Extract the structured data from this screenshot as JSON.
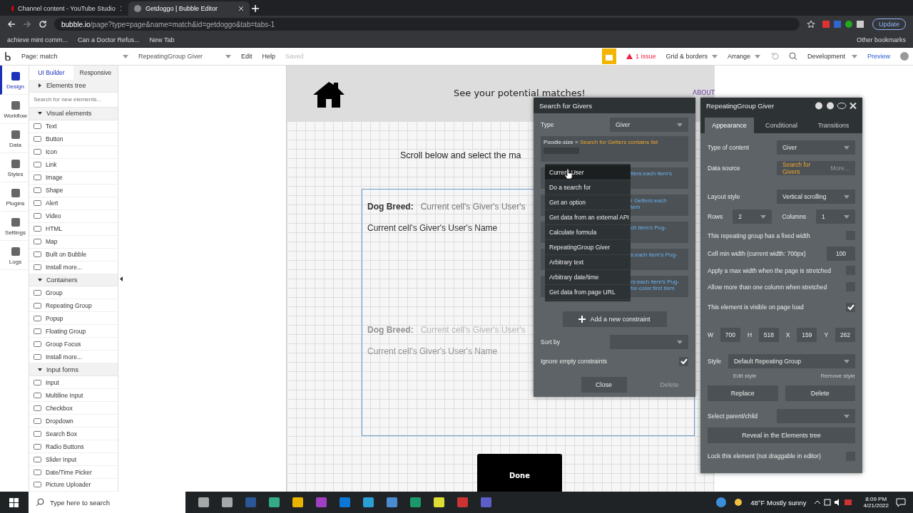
{
  "browser": {
    "tabs": [
      {
        "title": "Channel content - YouTube Studio",
        "selected": false
      },
      {
        "title": "Getdoggo | Bubble Editor",
        "selected": true
      }
    ],
    "url_host": "bubble.io",
    "url_path": "/page?type=page&name=match&id=getdoggo&tab=tabs-1",
    "update": "Update",
    "bookmarks": [
      "achieve mint comm...",
      "Can a Doctor Refus...",
      "New Tab"
    ],
    "other_bookmarks": "Other bookmarks"
  },
  "editor_toolbar": {
    "page": "Page: match",
    "element": "RepeatingGroup Giver",
    "menu": [
      "Edit",
      "Help"
    ],
    "saved": "Saved",
    "issues": "1 issue",
    "grid": "Grid & borders",
    "arrange": "Arrange",
    "mode": "Development",
    "preview": "Preview"
  },
  "rail": [
    {
      "label": "Design",
      "selected": true
    },
    {
      "label": "Workflow",
      "selected": false
    },
    {
      "label": "Data",
      "selected": false
    },
    {
      "label": "Styles",
      "selected": false
    },
    {
      "label": "Plugins",
      "selected": false
    },
    {
      "label": "Settings",
      "selected": false
    },
    {
      "label": "Logs",
      "selected": false
    }
  ],
  "builder_tabs": [
    {
      "label": "UI Builder",
      "selected": true
    },
    {
      "label": "Responsive",
      "selected": false
    }
  ],
  "elements_tree": {
    "label": "Elements tree",
    "expanded": false
  },
  "element_search": {
    "placeholder": "Search for new elements..."
  },
  "sections": [
    {
      "title": "Visual elements",
      "expanded": true,
      "items": [
        "Text",
        "Button",
        "Icon",
        "Link",
        "Image",
        "Shape",
        "Alert",
        "Video",
        "HTML",
        "Map",
        "Built on Bubble",
        "Install more..."
      ]
    },
    {
      "title": "Containers",
      "expanded": true,
      "items": [
        "Group",
        "Repeating Group",
        "Popup",
        "Floating Group",
        "Group Focus",
        "Install more..."
      ]
    },
    {
      "title": "Input forms",
      "expanded": true,
      "items": [
        "Input",
        "Multiline Input",
        "Checkbox",
        "Dropdown",
        "Search Box",
        "Radio Buttons",
        "Slider Input",
        "Date/Time Picker",
        "Picture Uploader"
      ]
    }
  ],
  "page": {
    "heading": "See your potential matches!",
    "about": "ABOUT",
    "intro": "Scroll below and select the ma",
    "cells": [
      {
        "label": "Dog Breed:",
        "value": "Current cell's Giver's User's",
        "name": "Current cell's Giver's User's Name",
        "dimmed": false
      },
      {
        "label": "Dog Breed:",
        "value": "Current cell's Giver's User's",
        "name": "Current cell's Giver's User's Name",
        "dimmed": true
      }
    ],
    "done": "Done"
  },
  "search_panel": {
    "title": "Search for Givers",
    "type_label": "Type",
    "type_value": "Giver",
    "constraint_key": "Poodle-size = ",
    "constraint_value": "Search for Getters contains list",
    "hidden_rows": [
      [
        "tters:each item's"
      ],
      [
        "r Getters:each",
        "tem"
      ],
      [
        "ch item's Pug-"
      ],
      [
        "s:each item's Pug-"
      ],
      [
        "rs:each item's Pug-",
        "for-color:first item"
      ]
    ],
    "menu": [
      {
        "label": "Current User",
        "selected": true
      },
      {
        "label": "Do a search for",
        "selected": false
      },
      {
        "label": "Get an option",
        "selected": false
      },
      {
        "label": "Get data from an external API",
        "selected": false
      },
      {
        "label": "Calculate formula",
        "selected": false
      },
      {
        "label": "RepeatingGroup Giver",
        "selected": false
      },
      {
        "label": "Arbitrary text",
        "selected": false
      },
      {
        "label": "Arbitrary date/time",
        "selected": false
      },
      {
        "label": "Get data from page URL",
        "selected": false
      }
    ],
    "add_constraint": "Add a new constraint",
    "sort_label": "Sort by",
    "ignore_label": "Ignore empty constraints",
    "ignore_checked": true,
    "close": "Close",
    "delete": "Delete",
    "delete_disabled": true
  },
  "property_panel": {
    "title": "RepeatingGroup Giver",
    "tabs": [
      {
        "label": "Appearance",
        "selected": true
      },
      {
        "label": "Conditional",
        "selected": false
      },
      {
        "label": "Transitions",
        "selected": false
      }
    ],
    "type_label": "Type of content",
    "type_value": "Giver",
    "source_label": "Data source",
    "source_value": "Search for Givers",
    "source_more": "More...",
    "layout_label": "Layout style",
    "layout_value": "Vertical scrolling",
    "rows_label": "Rows",
    "rows_value": "2",
    "cols_label": "Columns",
    "cols_value": "1",
    "fixed_width": {
      "label": "This repeating group has a fixed width",
      "checked": false
    },
    "min_width_label": "Cell min width (current width: 700px)",
    "min_width_value": "100",
    "options": [
      {
        "label": "Apply a max width when the page is stretched",
        "checked": false
      },
      {
        "label": "Allow more than one column when stretched",
        "checked": false
      }
    ],
    "visible": {
      "label": "This element is visible on page load",
      "checked": true
    },
    "geometry": [
      {
        "label": "W",
        "value": "700"
      },
      {
        "label": "H",
        "value": "518"
      },
      {
        "label": "X",
        "value": "159"
      },
      {
        "label": "Y",
        "value": "262"
      }
    ],
    "style_label": "Style",
    "style_value": "Default Repeating Group",
    "edit_style": "Edit style",
    "remove_style": "Remove style",
    "replace": "Replace",
    "delete": "Delete",
    "parent_label": "Select parent/child",
    "reveal": "Reveal in the Elements tree",
    "lock": {
      "label": "Lock this element (not draggable in editor)",
      "checked": false
    }
  },
  "taskbar": {
    "search_placeholder": "Type here to search",
    "weather": "48°F  Mostly sunny",
    "time": "8:09 PM",
    "date": "4/21/2022"
  }
}
